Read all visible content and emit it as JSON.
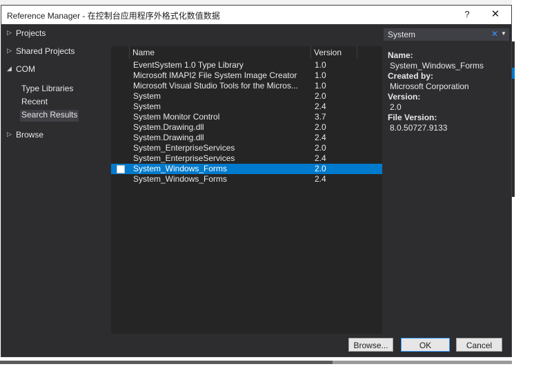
{
  "window": {
    "title": "Reference Manager - 在控制台应用程序外格式化数值数据",
    "help_label": "?",
    "close_label": "✕"
  },
  "nav": {
    "items": [
      {
        "label": "Projects",
        "arrow": "▷"
      },
      {
        "label": "Shared Projects",
        "arrow": "▷"
      },
      {
        "label": "COM",
        "arrow": "◢"
      },
      {
        "label": "Browse",
        "arrow": "▷"
      }
    ],
    "com_children": [
      {
        "label": "Type Libraries"
      },
      {
        "label": "Recent"
      },
      {
        "label": "Search Results",
        "selected": true
      }
    ]
  },
  "list": {
    "columns": [
      "Name",
      "Version"
    ],
    "rows": [
      {
        "name": "EventSystem 1.0 Type Library",
        "version": "1.0"
      },
      {
        "name": "Microsoft IMAPI2 File System Image Creator",
        "version": "1.0"
      },
      {
        "name": "Microsoft Visual Studio Tools for the Micros...",
        "version": "1.0"
      },
      {
        "name": "System",
        "version": "2.0"
      },
      {
        "name": "System",
        "version": "2.4"
      },
      {
        "name": "System Monitor Control",
        "version": "3.7"
      },
      {
        "name": "System.Drawing.dll",
        "version": "2.0"
      },
      {
        "name": "System.Drawing.dll",
        "version": "2.4"
      },
      {
        "name": "System_EnterpriseServices",
        "version": "2.0"
      },
      {
        "name": "System_EnterpriseServices",
        "version": "2.4"
      },
      {
        "name": "System_Windows_Forms",
        "version": "2.0",
        "selected": true
      },
      {
        "name": "System_Windows_Forms",
        "version": "2.4"
      }
    ]
  },
  "search": {
    "value": "System",
    "clear_glyph": "✕",
    "dropdown_glyph": "▼"
  },
  "details": {
    "name_label": "Name:",
    "name_value": "System_Windows_Forms",
    "created_label": "Created by:",
    "created_value": "Microsoft Corporation",
    "version_label": "Version:",
    "version_value": "2.0",
    "file_version_label": "File Version:",
    "file_version_value": "8.0.50727.9133"
  },
  "buttons": {
    "browse": "Browse...",
    "ok": "OK",
    "cancel": "Cancel"
  },
  "colors": {
    "dialog_bg": "#2d2d30",
    "list_bg": "#252526",
    "selection": "#007acc",
    "search_bg": "#3f3f46"
  }
}
